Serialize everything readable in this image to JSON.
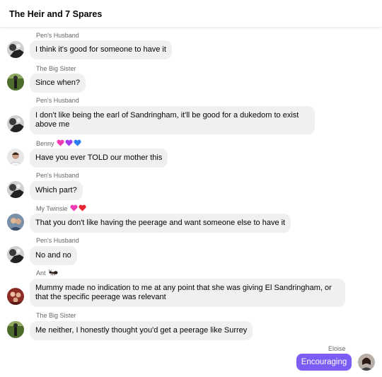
{
  "header": {
    "title": "The Heir and 7 Spares"
  },
  "messages": [
    {
      "sender": "Pen's Husband",
      "text": "I think it's good for someone to have it"
    },
    {
      "sender": "The Big Sister",
      "text": "Since when?"
    },
    {
      "sender": "Pen's Husband",
      "text": "I don't like being the earl of Sandringham, it'll be good for a dukedom to exist above me"
    },
    {
      "sender": "Benny",
      "text": "Have you ever TOLD our mother this"
    },
    {
      "sender": "Pen's Husband",
      "text": "Which part?"
    },
    {
      "sender": "My Twinsie",
      "text": "That you don't like having the peerage and want someone else to have it"
    },
    {
      "sender": "Pen's Husband",
      "text": "No and no"
    },
    {
      "sender": "Ant",
      "text": "Mummy made no indication to me at any point that she was giving El Sandringham, or that the specific peerage was relevant"
    },
    {
      "sender": "The Big Sister",
      "text": "Me neither, I honestly thought you'd get a peerage like Surrey"
    }
  ],
  "sent_message": {
    "sender": "Eloise",
    "text": "Encouraging"
  },
  "colors": {
    "sent_bubble": "#7b5cf5",
    "received_bubble": "#f0f0f0",
    "sender_name": "#65676b"
  },
  "icons": [
    "pink-heart-icon",
    "purple-heart-icon",
    "blue-heart-icon",
    "red-heart-icon",
    "ant-icon"
  ]
}
